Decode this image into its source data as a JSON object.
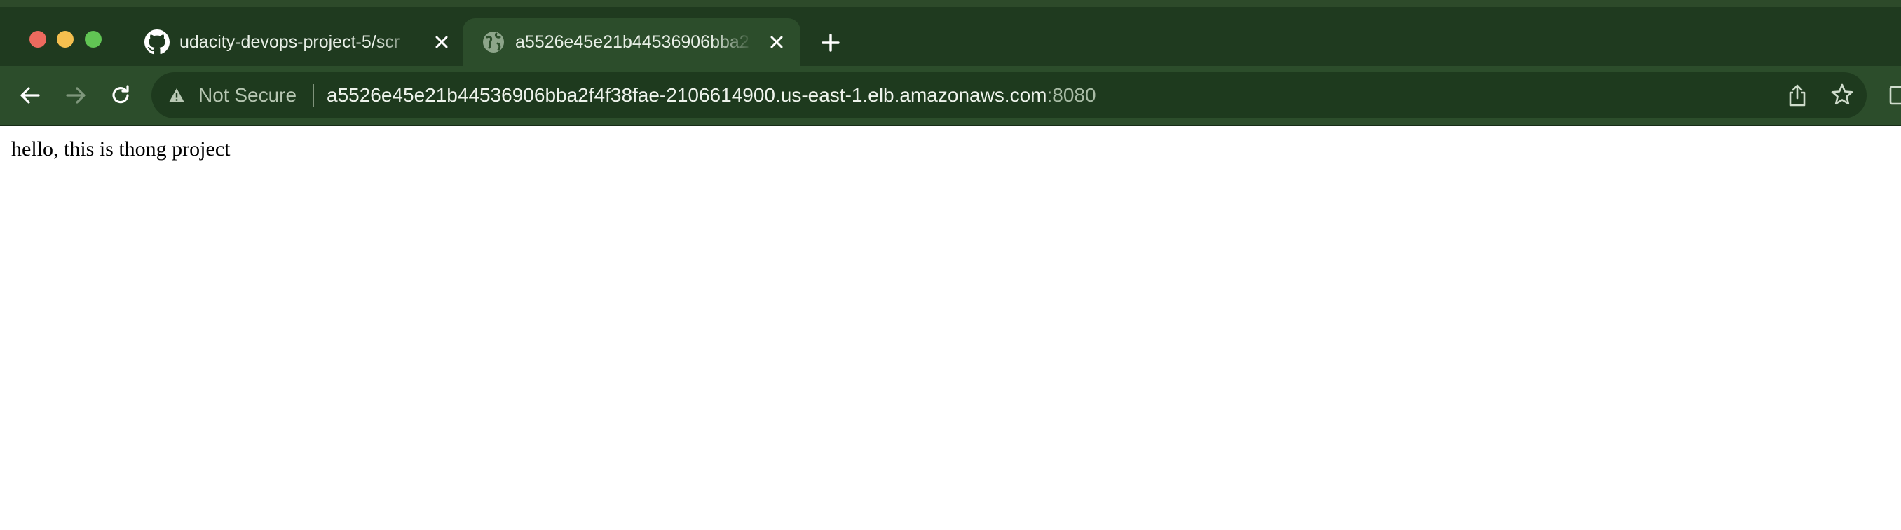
{
  "browser": {
    "tabs": [
      {
        "title": "udacity-devops-project-5/scr",
        "favicon": "github-icon",
        "active": false
      },
      {
        "title": "a5526e45e21b44536906bba2",
        "favicon": "globe-icon",
        "active": true
      }
    ],
    "address_bar": {
      "security_label": "Not Secure",
      "url_host": "a5526e45e21b44536906bba2f4f38fae-2106614900.us-east-1.elb.amazonaws.com",
      "url_port": ":8080"
    },
    "icons": [
      "back-arrow-icon",
      "forward-arrow-icon",
      "reload-icon",
      "warning-icon",
      "share-icon",
      "star-icon",
      "new-tab-icon",
      "close-icon"
    ]
  },
  "page": {
    "body_text": "hello, this is thong project"
  },
  "colors": {
    "tabstrip": "#1f3a1f",
    "toolbar": "#2c4d2b",
    "omnibox": "#1e3a1e"
  }
}
